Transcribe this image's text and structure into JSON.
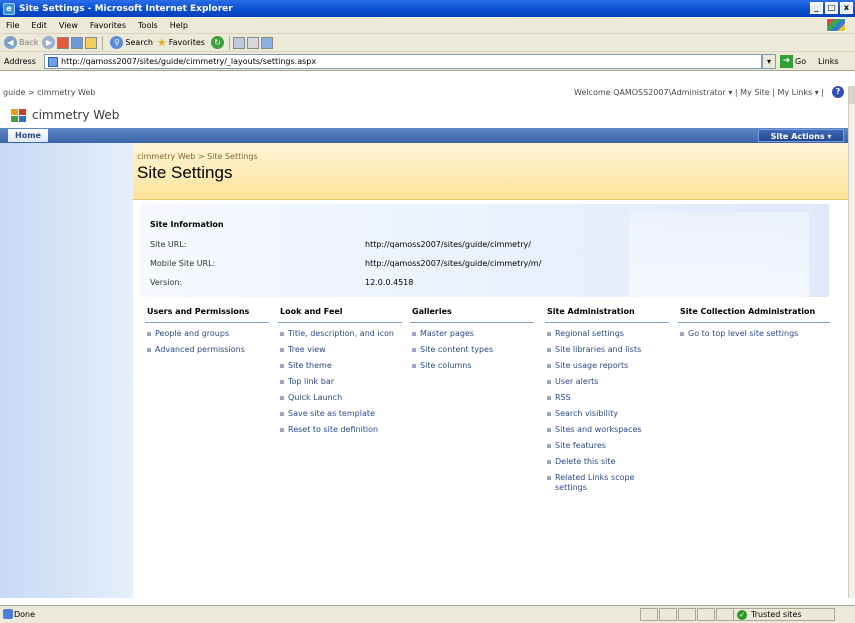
{
  "window": {
    "title": "Site Settings - Microsoft Internet Explorer",
    "min": "_",
    "max": "□",
    "close": "x"
  },
  "menu": [
    "File",
    "Edit",
    "View",
    "Favorites",
    "Tools",
    "Help"
  ],
  "toolbar": {
    "back": "Back",
    "search": "Search",
    "favorites": "Favorites"
  },
  "address": {
    "label": "Address",
    "url": "http://qamoss2007/sites/guide/cimmetry/_layouts/settings.aspx",
    "go": "Go",
    "links": "Links"
  },
  "sharepoint": {
    "top_breadcrumb": "guide > cimmetry Web",
    "welcome": "Welcome QAMOSS2007\\Administrator ▾ | My Site | My Links ▾ |",
    "help": "?",
    "site_title": "cimmetry Web",
    "home_tab": "Home",
    "site_actions": "Site Actions ▾",
    "page_breadcrumb": "cimmetry Web > Site Settings",
    "page_title": "Site Settings"
  },
  "site_info": {
    "heading": "Site Information",
    "rows": [
      {
        "label": "Site URL:",
        "value": "http://qamoss2007/sites/guide/cimmetry/"
      },
      {
        "label": "Mobile Site URL:",
        "value": "http://qamoss2007/sites/guide/cimmetry/m/"
      },
      {
        "label": "Version:",
        "value": "12.0.0.4518"
      }
    ]
  },
  "columns": [
    {
      "heading": "Users and Permissions",
      "links": [
        "People and groups",
        "Advanced permissions"
      ]
    },
    {
      "heading": "Look and Feel",
      "links": [
        "Title, description, and icon",
        "Tree view",
        "Site theme",
        "Top link bar",
        "Quick Launch",
        "Save site as template",
        "Reset to site definition"
      ]
    },
    {
      "heading": "Galleries",
      "links": [
        "Master pages",
        "Site content types",
        "Site columns"
      ]
    },
    {
      "heading": "Site Administration",
      "links": [
        "Regional settings",
        "Site libraries and lists",
        "Site usage reports",
        "User alerts",
        "RSS",
        "Search visibility",
        "Sites and workspaces",
        "Site features",
        "Delete this site",
        "Related Links scope settings"
      ]
    },
    {
      "heading": "Site Collection Administration",
      "links": [
        "Go to top level site settings"
      ]
    }
  ],
  "status": {
    "text": "Done",
    "zone": "Trusted sites"
  },
  "colors": {
    "titlebar": "#0a4bd0",
    "topnav": "#3c65a8",
    "header": "#fde39a",
    "link": "#2a4a8a"
  }
}
